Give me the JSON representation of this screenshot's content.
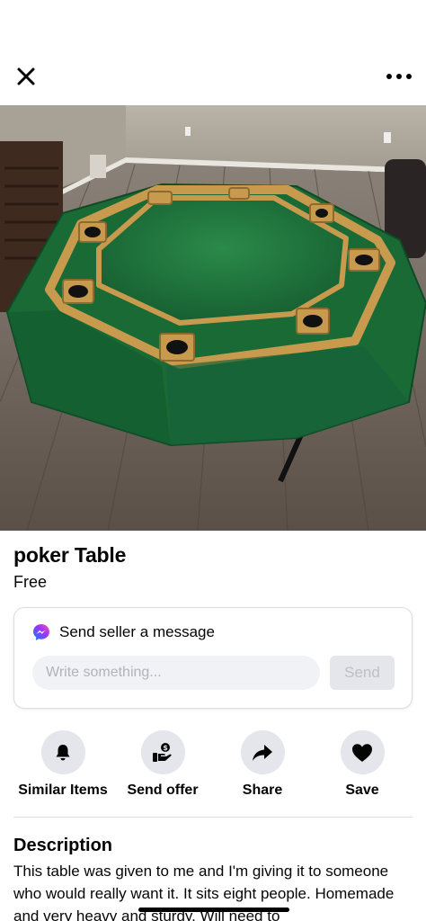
{
  "topbar": {
    "close_icon": "close-icon",
    "more_icon": "more-horizontal-icon"
  },
  "listing": {
    "title": "poker Table",
    "price": "Free",
    "photo": "poker-table-photo"
  },
  "message_card": {
    "icon": "messenger-icon",
    "heading": "Send seller a message",
    "input_placeholder": "Write something...",
    "input_value": "",
    "send_label": "Send"
  },
  "actions": [
    {
      "icon": "bell-icon",
      "label": "Similar Items"
    },
    {
      "icon": "offer-hand-icon",
      "label": "Send offer"
    },
    {
      "icon": "share-arrow-icon",
      "label": "Share"
    },
    {
      "icon": "heart-icon",
      "label": "Save"
    }
  ],
  "description": {
    "heading": "Description",
    "text": "This table was given to me and I'm giving it to someone who would really want it. It sits eight people. Homemade and very heavy and sturdy. Will need to"
  },
  "colors": {
    "text": "#050505",
    "button_bg": "#e4e6eb",
    "input_bg": "#f0f2f5",
    "placeholder": "#b0b3b8",
    "felt_green": "#1f6e3a",
    "wood": "#c89a4e"
  }
}
